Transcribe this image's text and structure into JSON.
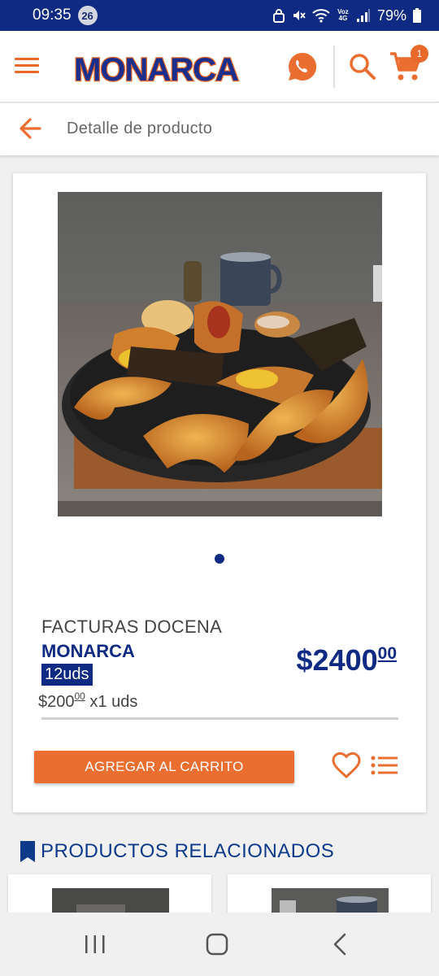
{
  "status_bar": {
    "time": "09:35",
    "notification_count": "26",
    "network_label": "Voz 4G",
    "battery": "79%"
  },
  "header": {
    "logo_text": "MONARCA",
    "cart_count": "1"
  },
  "sub_header": {
    "title": "Detalle de producto"
  },
  "product": {
    "name": "FACTURAS DOCENA",
    "brand": "MONARCA",
    "qty_label": "12uds",
    "unit_price_main": "$200",
    "unit_price_cents": "00",
    "unit_price_suffix": " x1 uds",
    "price_main": "$2400",
    "price_cents": "00",
    "add_to_cart_label": "AGREGAR AL CARRITO"
  },
  "related": {
    "title": "PRODUCTOS RELACIONADOS"
  },
  "colors": {
    "brand_blue": "#0e2a82",
    "accent_orange": "#ea6e30"
  }
}
